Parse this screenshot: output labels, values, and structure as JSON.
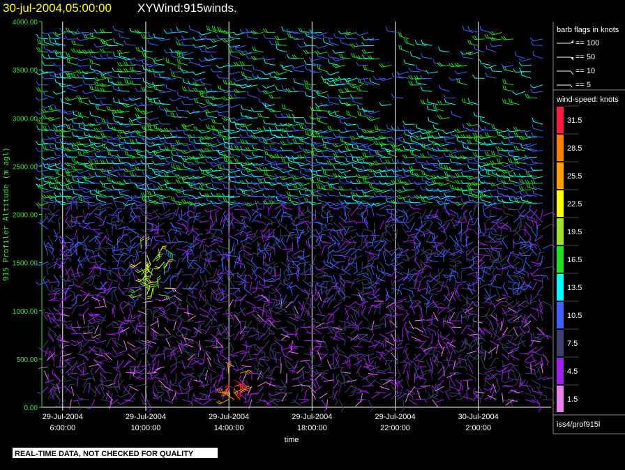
{
  "header": {
    "date_text": "30-jul-2004,05:00:00",
    "title_text": "XYWind:915winds."
  },
  "chart_data": {
    "type": "wind-barb-time-height",
    "ylabel": "915 Profiler Altitude (m agl)",
    "xlabel": "time",
    "ylim": [
      0,
      4000
    ],
    "y_ticks": [
      "4000.00",
      "3500.00",
      "3000.00",
      "2500.00",
      "2000.00",
      "1500.00",
      "1000.00",
      "500.00",
      "0.00"
    ],
    "y_tick_values": [
      4000,
      3500,
      3000,
      2500,
      2000,
      1500,
      1000,
      500,
      0
    ],
    "x_ticks": [
      {
        "date": "29-Jul-2004",
        "time": "6:00:00",
        "hour": 6
      },
      {
        "date": "29-Jul-2004",
        "time": "10:00:00",
        "hour": 10
      },
      {
        "date": "29-Jul-2004",
        "time": "14:00:00",
        "hour": 14
      },
      {
        "date": "29-Jul-2004",
        "time": "18:00:00",
        "hour": 18
      },
      {
        "date": "29-Jul-2004",
        "time": "22:00:00",
        "hour": 22
      },
      {
        "date": "30-Jul-2004",
        "time": "2:00:00",
        "hour": 26
      }
    ],
    "xlim_hours": [
      5.0,
      29.5
    ],
    "grid_x": true
  },
  "legend": {
    "barb_title": "barb flags in knots",
    "barb_items": [
      "== 100",
      "== 50",
      "== 10",
      "== 5"
    ],
    "speed_title": "wind-speed: knots",
    "speed_scale": [
      {
        "label": "31.5",
        "color": "#ff1a40"
      },
      {
        "label": "28.5",
        "color": "#ff8000"
      },
      {
        "label": "25.5",
        "color": "#ffa000"
      },
      {
        "label": "22.5",
        "color": "#ffff00"
      },
      {
        "label": "19.5",
        "color": "#a0e030"
      },
      {
        "label": "16.5",
        "color": "#20e020"
      },
      {
        "label": "13.5",
        "color": "#00ffff"
      },
      {
        "label": "10.5",
        "color": "#4060ff"
      },
      {
        "label": "7.5",
        "color": "#404070"
      },
      {
        "label": "4.5",
        "color": "#a020f0"
      },
      {
        "label": "1.5",
        "color": "#f080f0"
      }
    ],
    "source_label": "iss4/prof915l"
  },
  "footer": {
    "qc_notice": "REAL-TIME DATA, NOT CHECKED FOR QUALITY"
  }
}
